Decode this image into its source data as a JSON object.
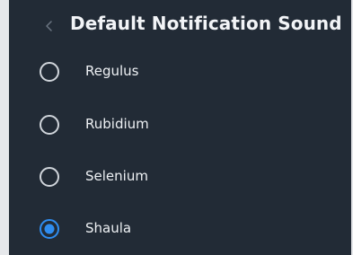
{
  "header": {
    "title": "Default Notification Sound",
    "back_icon": "chevron-left-icon"
  },
  "options": [
    {
      "label": "Regulus",
      "selected": false
    },
    {
      "label": "Rubidium",
      "selected": false
    },
    {
      "label": "Selenium",
      "selected": false
    },
    {
      "label": "Shaula",
      "selected": true
    }
  ],
  "colors": {
    "background": "#222b36",
    "accent": "#2f8df0",
    "radio_unselected": "#d0d5db",
    "text": "#eef1f4"
  }
}
